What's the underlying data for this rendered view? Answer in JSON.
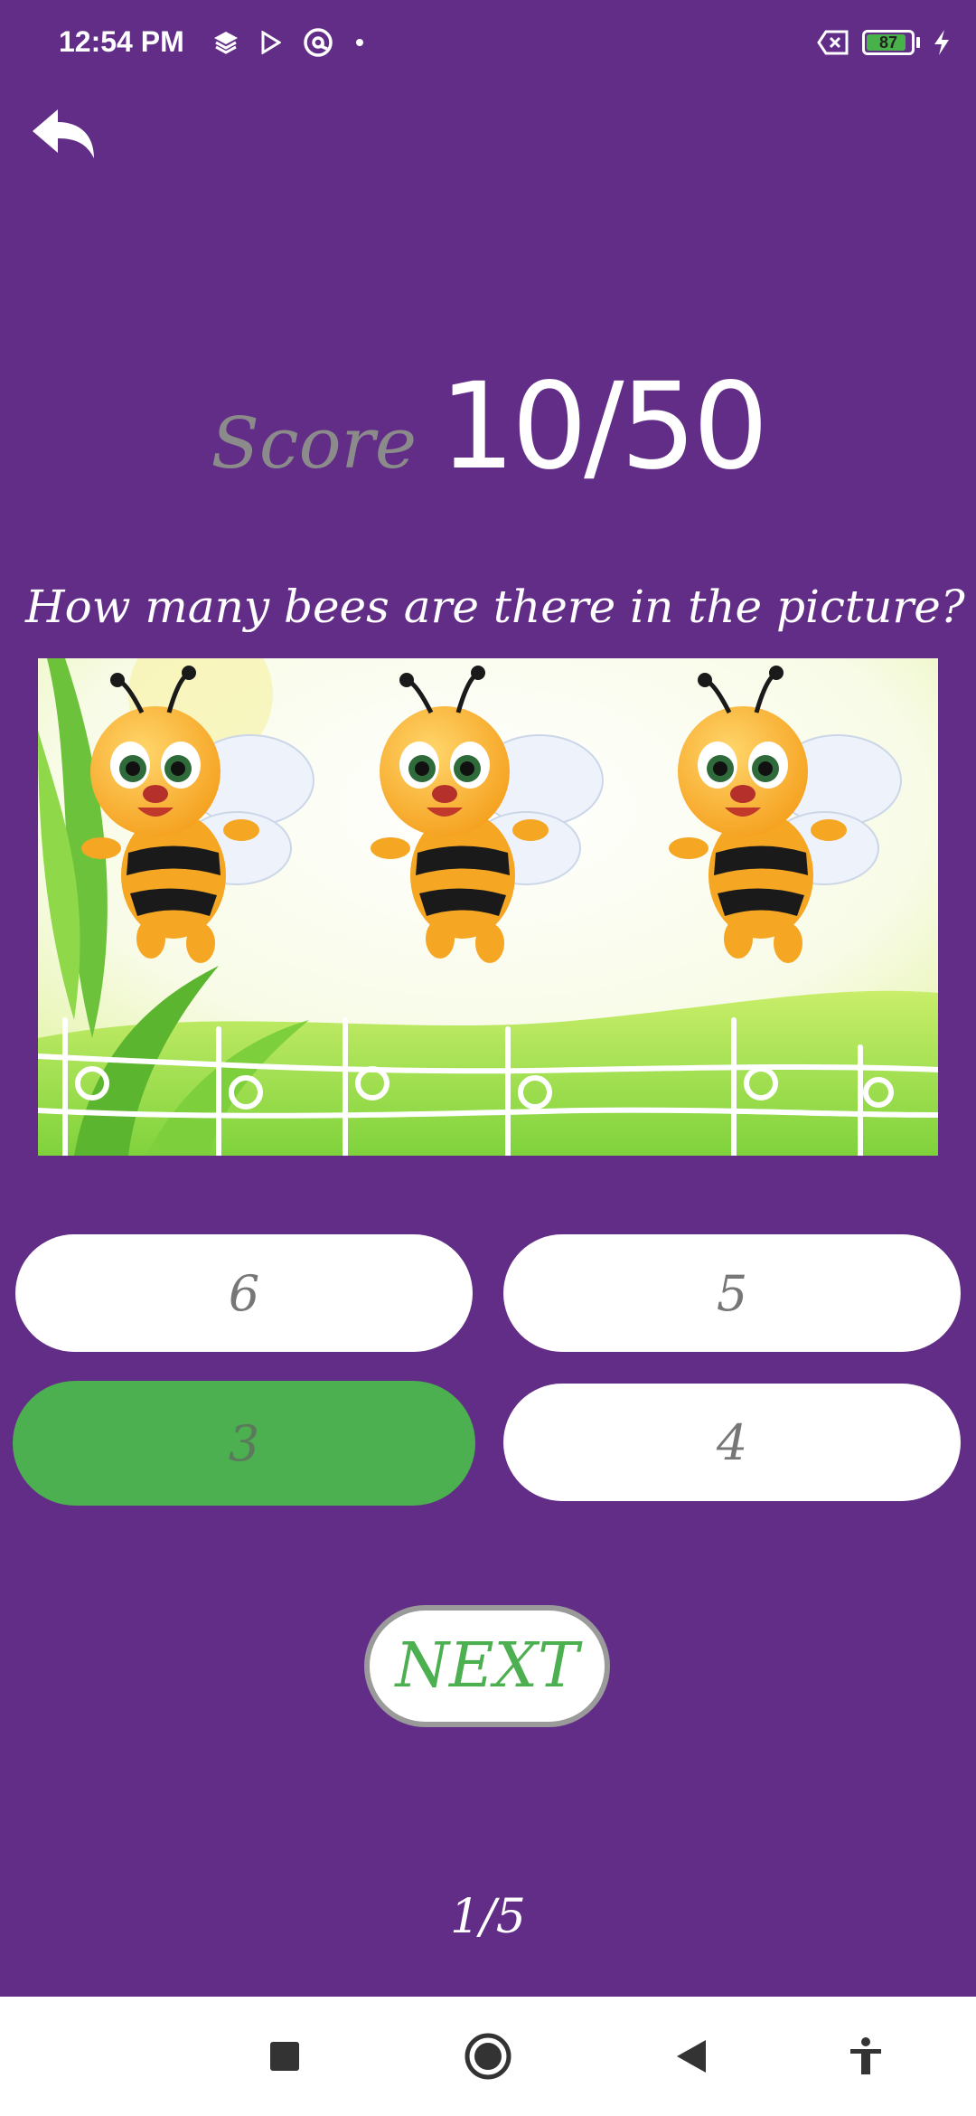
{
  "status_bar": {
    "time": "12:54 PM",
    "battery_level": "87",
    "icons": [
      "layers-icon",
      "play-store-icon",
      "at-sign-icon",
      "dot-icon",
      "no-sim-icon",
      "battery-icon",
      "charging-bolt-icon"
    ]
  },
  "header": {
    "back_icon": "back-arrow-icon"
  },
  "score": {
    "label": "Score",
    "value": "10/50"
  },
  "question": {
    "text": "How many bees are there in the picture?"
  },
  "picture": {
    "subject": "three-cartoon-bees"
  },
  "answers": [
    {
      "label": "6",
      "state": "default"
    },
    {
      "label": "5",
      "state": "default"
    },
    {
      "label": "3",
      "state": "correct"
    },
    {
      "label": "4",
      "state": "default"
    }
  ],
  "next_button": {
    "label": "NEXT"
  },
  "progress": {
    "text": "1/5"
  },
  "nav_bar": {
    "items": [
      "recents-square-icon",
      "home-circle-icon",
      "back-triangle-icon",
      "accessibility-icon"
    ]
  },
  "colors": {
    "background": "#622d87",
    "correct": "#4caf50",
    "button": "#ffffff",
    "score_label": "#8b8b8b"
  }
}
